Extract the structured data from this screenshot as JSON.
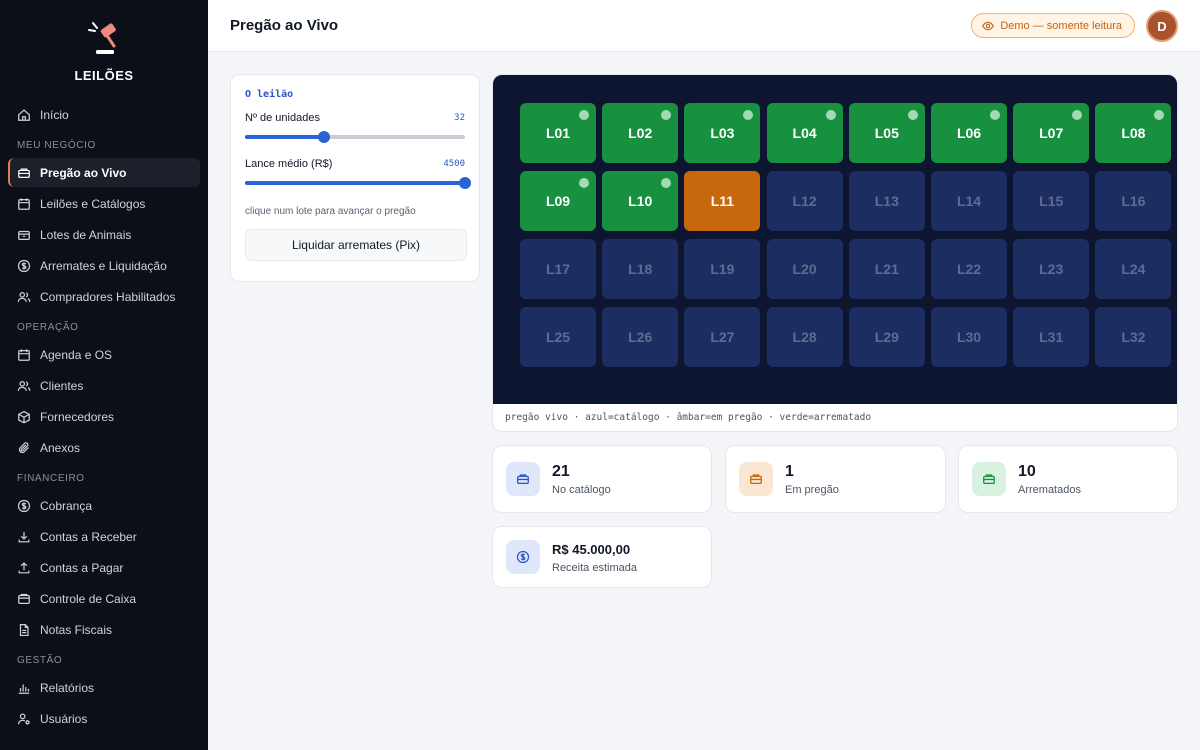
{
  "app": {
    "name": "LEILÕES"
  },
  "sidebar": {
    "inicio": "Início",
    "sections": {
      "meu_negocio": "MEU NEGÓCIO",
      "operacao": "OPERAÇÃO",
      "financeiro": "FINANCEIRO",
      "gestao": "GESTÃO"
    },
    "meu_negocio": [
      {
        "label": "Pregão ao Vivo",
        "icon": "gavel-box-icon",
        "active": true
      },
      {
        "label": "Leilões e Catálogos",
        "icon": "calendar-icon"
      },
      {
        "label": "Lotes de Animais",
        "icon": "box-icon"
      },
      {
        "label": "Arremates e Liquidação",
        "icon": "dollar-circle-icon"
      },
      {
        "label": "Compradores Habilitados",
        "icon": "users-icon"
      }
    ],
    "operacao": [
      {
        "label": "Agenda e OS",
        "icon": "calendar-icon"
      },
      {
        "label": "Clientes",
        "icon": "users-icon"
      },
      {
        "label": "Fornecedores",
        "icon": "package-icon"
      },
      {
        "label": "Anexos",
        "icon": "paperclip-icon"
      }
    ],
    "financeiro": [
      {
        "label": "Cobrança",
        "icon": "dollar-circle-icon"
      },
      {
        "label": "Contas a Receber",
        "icon": "download-icon"
      },
      {
        "label": "Contas a Pagar",
        "icon": "upload-icon"
      },
      {
        "label": "Controle de Caixa",
        "icon": "wallet-icon"
      },
      {
        "label": "Notas Fiscais",
        "icon": "file-icon"
      }
    ],
    "gestao": [
      {
        "label": "Relatórios",
        "icon": "bar-chart-icon"
      },
      {
        "label": "Usuários",
        "icon": "user-cog-icon"
      }
    ]
  },
  "header": {
    "title": "Pregão ao Vivo",
    "demo_badge": "Demo — somente leitura",
    "avatar_initial": "D"
  },
  "controls": {
    "heading": "O leilão",
    "units": {
      "label": "Nº de unidades",
      "value": "32",
      "fraction": 0.36
    },
    "bid": {
      "label": "Lance médio (R$)",
      "value": "4500",
      "fraction": 1.0
    },
    "hint": "clique num lote para avançar o pregão",
    "liquidar_label": "Liquidar arremates (Pix)"
  },
  "board": {
    "caption": "pregão vivo · azul=catálogo · âmbar=em pregão · verde=arrematado",
    "lots": [
      {
        "id": "L01",
        "status": "arrematado"
      },
      {
        "id": "L02",
        "status": "arrematado"
      },
      {
        "id": "L03",
        "status": "arrematado"
      },
      {
        "id": "L04",
        "status": "arrematado"
      },
      {
        "id": "L05",
        "status": "arrematado"
      },
      {
        "id": "L06",
        "status": "arrematado"
      },
      {
        "id": "L07",
        "status": "arrematado"
      },
      {
        "id": "L08",
        "status": "arrematado"
      },
      {
        "id": "L09",
        "status": "arrematado"
      },
      {
        "id": "L10",
        "status": "arrematado"
      },
      {
        "id": "L11",
        "status": "em_pregao"
      },
      {
        "id": "L12",
        "status": "catalogo"
      },
      {
        "id": "L13",
        "status": "catalogo"
      },
      {
        "id": "L14",
        "status": "catalogo"
      },
      {
        "id": "L15",
        "status": "catalogo"
      },
      {
        "id": "L16",
        "status": "catalogo"
      },
      {
        "id": "L17",
        "status": "catalogo"
      },
      {
        "id": "L18",
        "status": "catalogo"
      },
      {
        "id": "L19",
        "status": "catalogo"
      },
      {
        "id": "L20",
        "status": "catalogo"
      },
      {
        "id": "L21",
        "status": "catalogo"
      },
      {
        "id": "L22",
        "status": "catalogo"
      },
      {
        "id": "L23",
        "status": "catalogo"
      },
      {
        "id": "L24",
        "status": "catalogo"
      },
      {
        "id": "L25",
        "status": "catalogo"
      },
      {
        "id": "L26",
        "status": "catalogo"
      },
      {
        "id": "L27",
        "status": "catalogo"
      },
      {
        "id": "L28",
        "status": "catalogo"
      },
      {
        "id": "L29",
        "status": "catalogo"
      },
      {
        "id": "L30",
        "status": "catalogo"
      },
      {
        "id": "L31",
        "status": "catalogo"
      },
      {
        "id": "L32",
        "status": "catalogo"
      }
    ]
  },
  "stats": {
    "catalogo": {
      "value": "21",
      "label": "No catálogo"
    },
    "pregao": {
      "value": "1",
      "label": "Em pregão"
    },
    "arrematados": {
      "value": "10",
      "label": "Arrematados"
    },
    "receita": {
      "value": "R$ 45.000,00",
      "label": "Receita estimada"
    }
  },
  "colors": {
    "arrematado": "#17913f",
    "em_pregao": "#c7680e",
    "catalogo": "#1c2d62",
    "accent": "#2a63d4"
  }
}
